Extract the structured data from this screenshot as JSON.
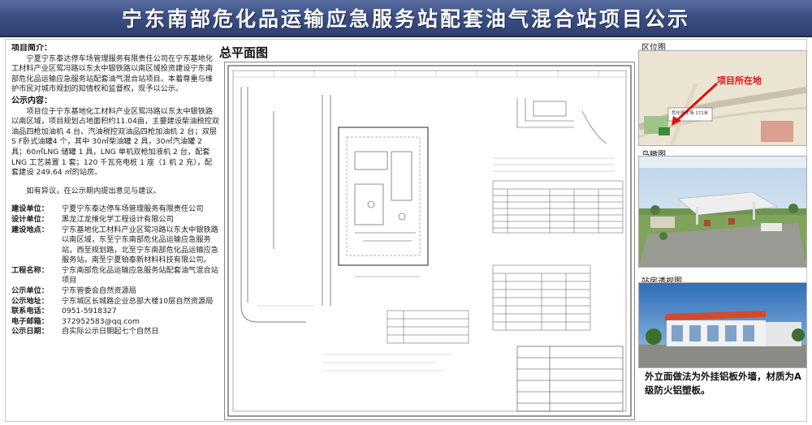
{
  "banner": {
    "title": "宁东南部危化品运输应急服务站配套油气混合站项目公示"
  },
  "project_intro": {
    "heading": "项目简介：",
    "text": "宁夏宁东泰达停车场管理服务有限责任公司在宁东基地化工材料产业区鸳冯路以东太中银铁路以南区域投资建设宁东南部危化品运输应急服务站配套油气混合站项目。本着尊重与维护市民对城市规划的知情权和监督权，现予以公示。"
  },
  "announcement": {
    "heading": "公示内容：",
    "text": "项目位于宁东基地化工材料产业区鸳冯路以东太中银铁路以南区域，项目规划占地面积约11.04亩，主要建设柴油税控双油品四枪加油机 4 台、汽油税控双油品四枪加油机 2 台；双层 S F卧式油罐4 个，其中 30㎥柴油罐 2 具，30㎥汽油罐 2 具；60㎥LNG 储罐 1 具，LNG 单机双枪加液机 2 台，配套 LNG 工艺装置 1 套；120 千瓦充电桩 1 座（1 机 2 充），配套建设 249.64 ㎡的站房。",
    "objection": "如有异议，在公示期内提出意见与建议。"
  },
  "details": [
    {
      "label": "建设单位：",
      "value": "宁夏宁东泰达停车场管理服务有限责任公司"
    },
    {
      "label": "设计单位：",
      "value": "黑龙江龙维化学工程设计有限公司"
    },
    {
      "label": "建设地点：",
      "value": "宁东基地化工材料产业区鸳冯路以东太中银铁路以南区域，东至宁东南部危化品运输应急服务站，西至规划路，北至宁东南部危化品运输应急服务站，南至宁夏铂泰新材料科技有限公司。"
    },
    {
      "label": "工程名称：",
      "value": "宁东南部危化品运输应急服务站配套油气混合站项目"
    },
    {
      "label": "公示单位：",
      "value": "宁东管委会自然资源局"
    },
    {
      "label": "公示地址：",
      "value": "宁东城区长城路企业总部大楼10层自然资源局"
    },
    {
      "label": "联系电话：",
      "value": "0951-5918327"
    },
    {
      "label": "电子邮箱：",
      "value": "372952583@qq.com"
    },
    {
      "label": "公示日期：",
      "value": "自实际公示日期起七个自然日"
    }
  ],
  "plan": {
    "title": "总平面图"
  },
  "location": {
    "label": "区位图",
    "callout": "项目所在地",
    "sign": "危化停车场 171米"
  },
  "aerial": {
    "label": "鸟瞰图"
  },
  "station": {
    "label": "站房透视图"
  },
  "caption": {
    "text": "外立面做法为外挂铝板外墙，材质为A级防火铝塑板。"
  }
}
